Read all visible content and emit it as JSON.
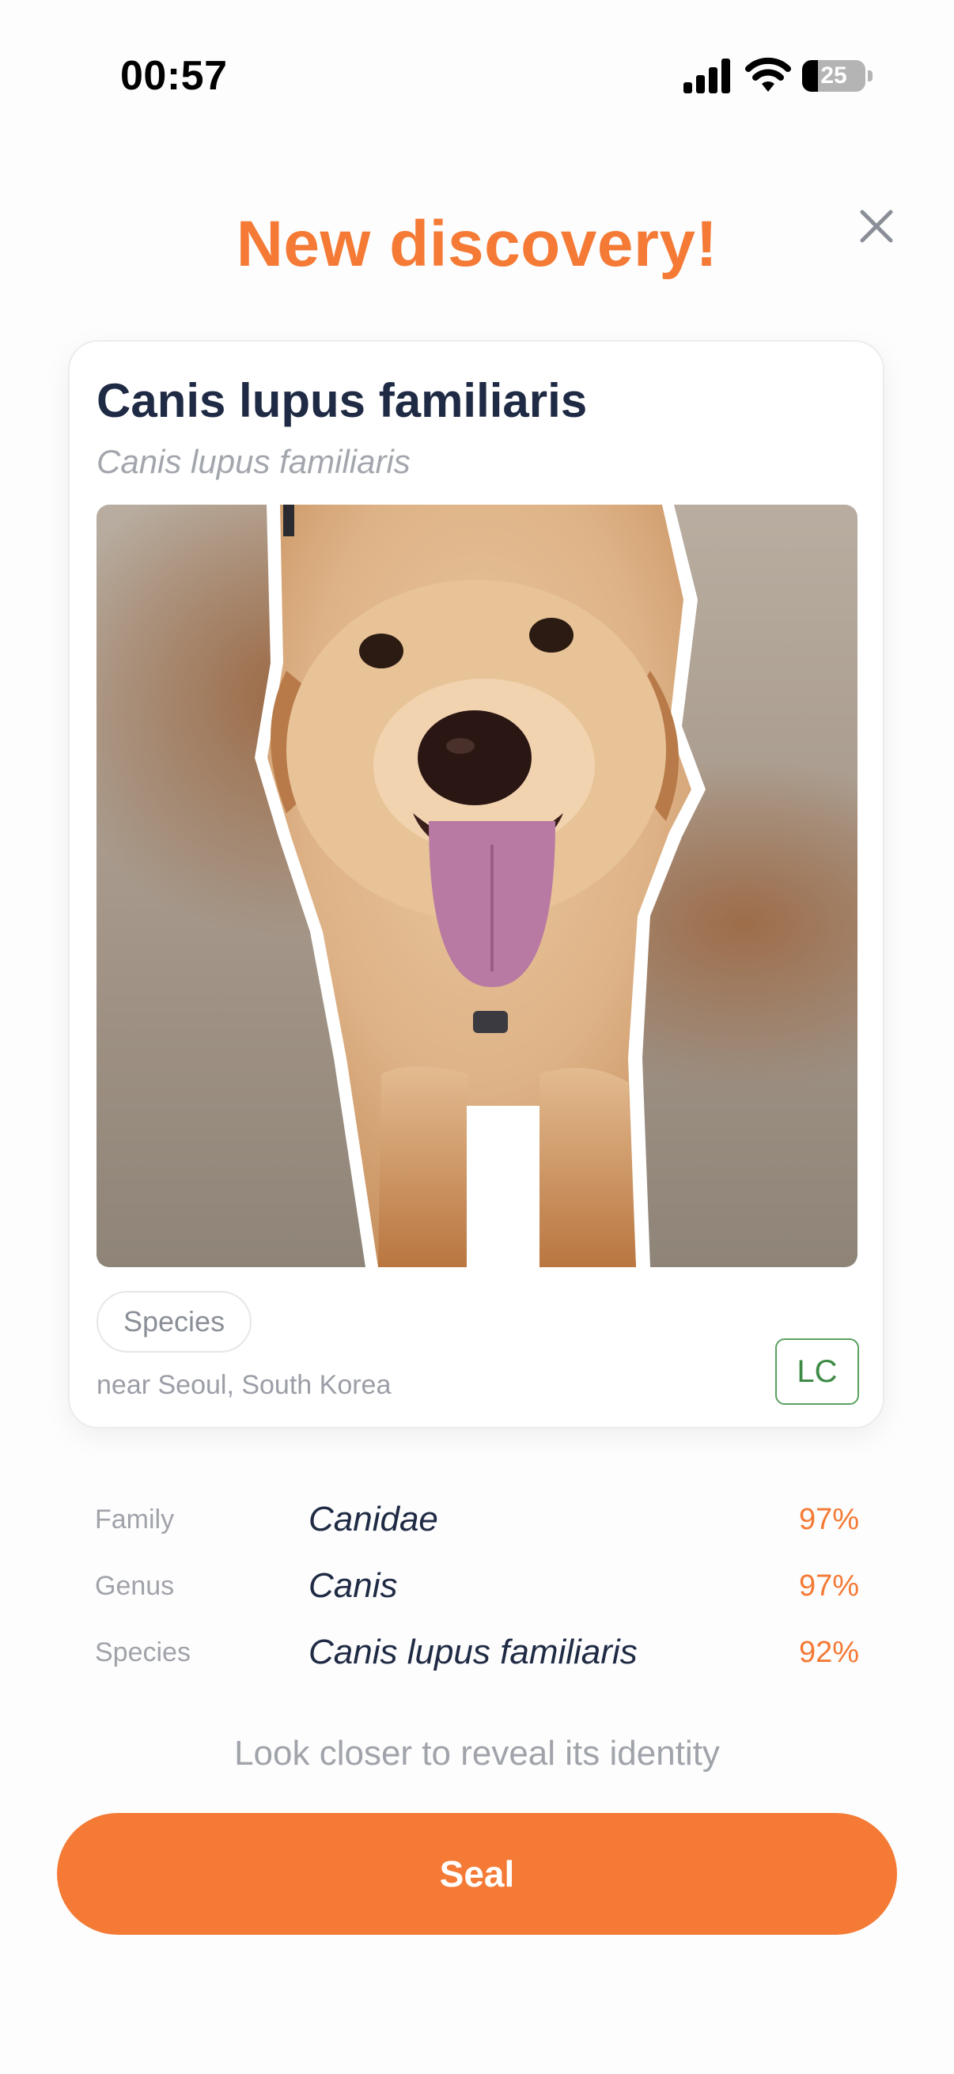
{
  "status_bar": {
    "time": "00:57",
    "battery_level": "25",
    "battery_fraction": 0.25
  },
  "header": {
    "title": "New discovery!",
    "close_icon": "close-icon"
  },
  "card": {
    "common_name": "Canis lupus familiaris",
    "scientific_name": "Canis lupus familiaris",
    "photo_icon": "dog-photo",
    "rank_pill": "Species",
    "location": "near Seoul, South Korea",
    "conservation_status": "LC"
  },
  "taxonomy": [
    {
      "rank": "Family",
      "name": "Canidae",
      "confidence": "97%"
    },
    {
      "rank": "Genus",
      "name": "Canis",
      "confidence": "97%"
    },
    {
      "rank": "Species",
      "name": "Canis lupus familiaris",
      "confidence": "92%"
    }
  ],
  "hint": "Look closer to reveal its identity",
  "action": {
    "seal_label": "Seal"
  },
  "colors": {
    "accent": "#f47a35",
    "status_green": "#3e8b46",
    "title_text": "#1f2a44"
  }
}
